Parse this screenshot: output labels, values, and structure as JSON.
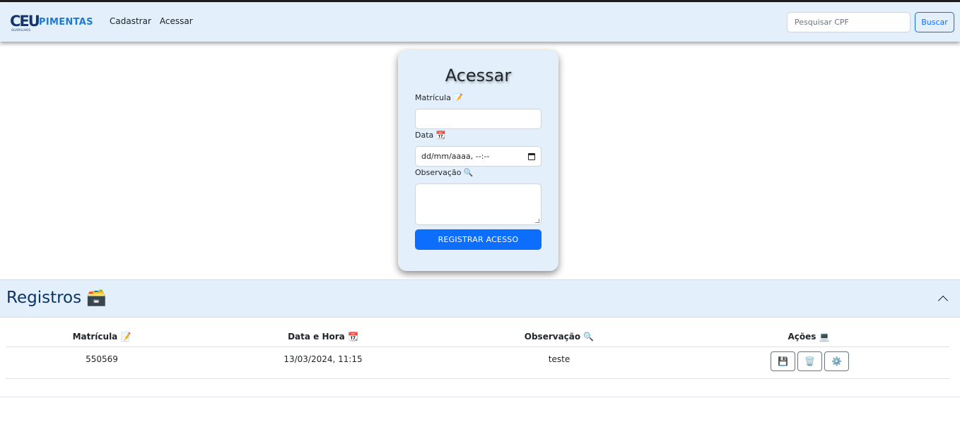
{
  "navbar": {
    "logo_mark": "CEU",
    "logo_word": "PIMENTAS",
    "logo_sub": "GUARULHOS",
    "links": [
      "Cadastrar",
      "Acessar"
    ],
    "search_placeholder": "Pesquisar CPF",
    "search_button": "Buscar"
  },
  "form": {
    "title": "Acessar",
    "matricula_label": "Matrícula 📝",
    "data_label": "Data 📆",
    "data_placeholder": "dd/mm/aaaa, --:--",
    "observacao_label": "Observação 🔍",
    "submit_label": "REGISTRAR ACESSO"
  },
  "registros": {
    "title": "Registros 🗃️",
    "columns": [
      "Matrícula 📝",
      "Data e Hora 📆",
      "Observação 🔍",
      "Ações 💻"
    ],
    "rows": [
      {
        "matricula": "550569",
        "data_hora": "13/03/2024, 11:15",
        "observacao": "teste"
      }
    ],
    "actions": [
      "💾",
      "🗑️",
      "⚙️"
    ]
  },
  "colors": {
    "navbar_bg": "#e3f0fb",
    "primary": "#0d6efd",
    "title_blue": "#0c3366"
  }
}
